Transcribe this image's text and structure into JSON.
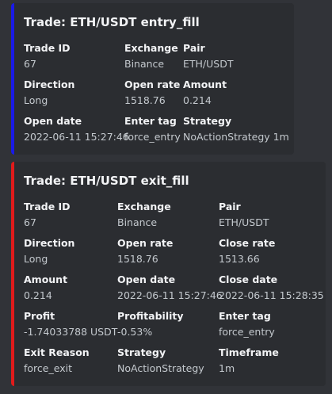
{
  "entry": {
    "title": "Trade: ETH/USDT entry_fill",
    "accent_color": "#1a1ae6",
    "fields": [
      {
        "name": "Trade ID",
        "value": "67"
      },
      {
        "name": "Exchange",
        "value": "Binance"
      },
      {
        "name": "Pair",
        "value": "ETH/USDT"
      },
      {
        "name": "Direction",
        "value": "Long"
      },
      {
        "name": "Open rate",
        "value": "1518.76"
      },
      {
        "name": "Amount",
        "value": "0.214"
      },
      {
        "name": "Open date",
        "value": "2022-06-11 15:27:46"
      },
      {
        "name": "Enter tag",
        "value": "force_entry"
      },
      {
        "name": "Strategy",
        "value": "NoActionStrategy 1m"
      }
    ]
  },
  "exit": {
    "title": "Trade: ETH/USDT exit_fill",
    "accent_color": "#e01b1b",
    "fields": [
      {
        "name": "Trade ID",
        "value": "67"
      },
      {
        "name": "Exchange",
        "value": "Binance"
      },
      {
        "name": "Pair",
        "value": "ETH/USDT"
      },
      {
        "name": "Direction",
        "value": "Long"
      },
      {
        "name": "Open rate",
        "value": "1518.76"
      },
      {
        "name": "Close rate",
        "value": "1513.66"
      },
      {
        "name": "Amount",
        "value": "0.214"
      },
      {
        "name": "Open date",
        "value": "2022-06-11 15:27:46"
      },
      {
        "name": "Close date",
        "value": "2022-06-11 15:28:35"
      },
      {
        "name": "Profit",
        "value": "-1.74033788 USDT"
      },
      {
        "name": "Profitability",
        "value": "-0.53%"
      },
      {
        "name": "Enter tag",
        "value": "force_entry"
      },
      {
        "name": "Exit Reason",
        "value": "force_exit"
      },
      {
        "name": "Strategy",
        "value": "NoActionStrategy"
      },
      {
        "name": "Timeframe",
        "value": "1m"
      }
    ]
  }
}
